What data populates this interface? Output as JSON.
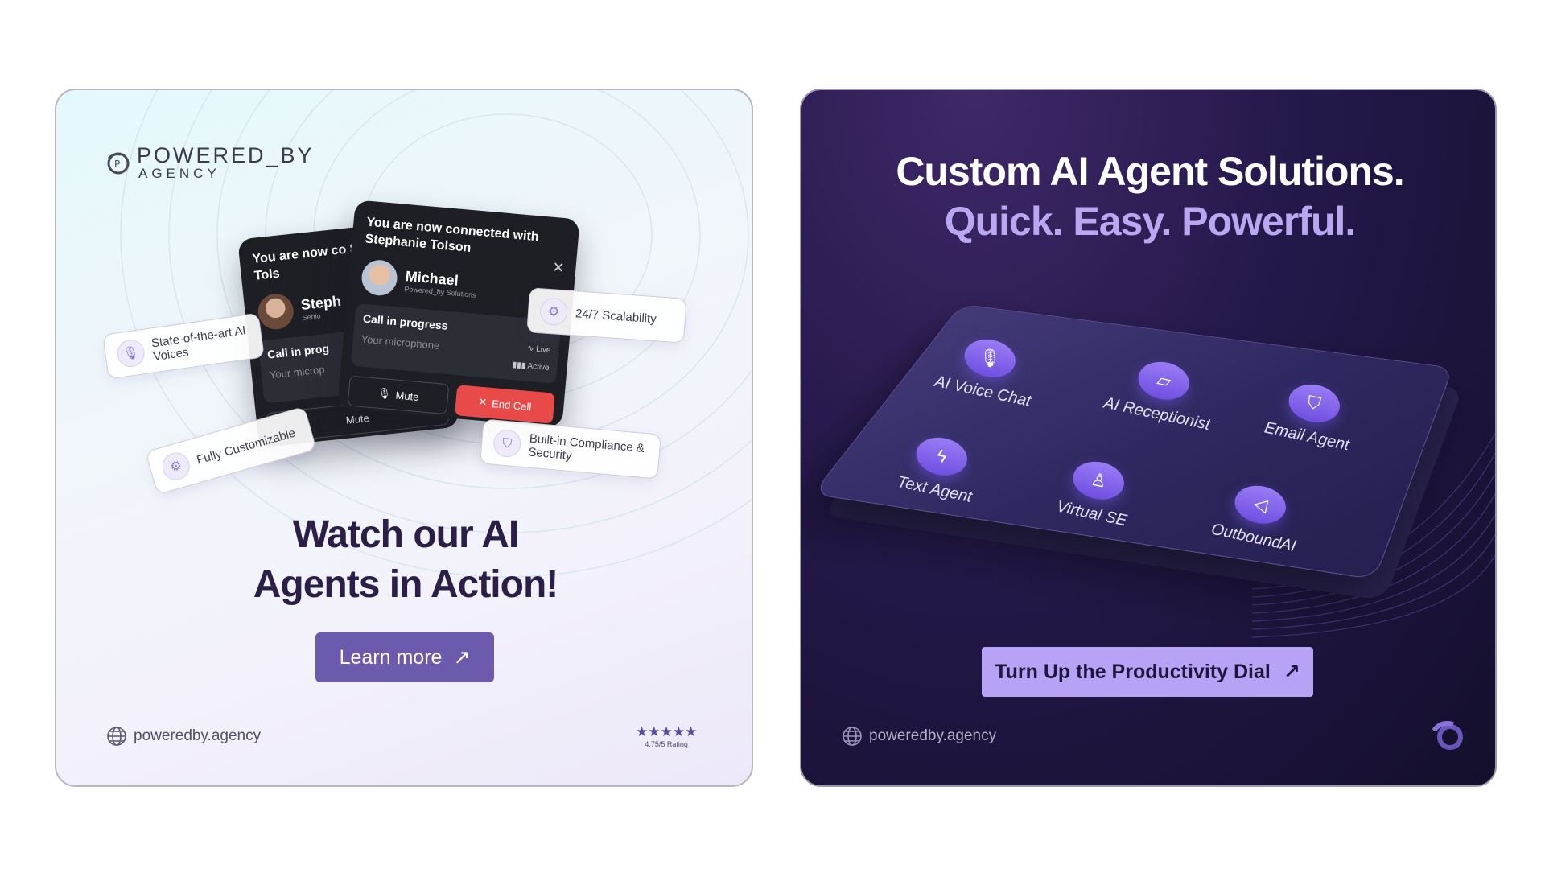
{
  "left_card": {
    "brand": {
      "line1": "POWERED_BY",
      "line2": "AGENCY"
    },
    "call_back": {
      "title": "You are now co Stephanie Tols",
      "caller_name": "Steph",
      "caller_role": "Senio",
      "progress_title": "Call in prog",
      "mic_label": "Your microp",
      "mute_label": "Mute"
    },
    "call_front": {
      "title": "You are now connected with Stephanie Tolson",
      "caller_name": "Michael",
      "caller_company": "Powered_by Solutions",
      "progress_title": "Call in progress",
      "mic_label": "Your microphone",
      "live_label": "Live",
      "active_label": "Active",
      "mute_label": "Mute",
      "end_call_label": "End Call"
    },
    "chips": {
      "voices": "State-of-the-art AI Voices",
      "scalability": "24/7 Scalability",
      "customizable": "Fully Customizable",
      "compliance": "Built-in Compliance & Security"
    },
    "headline_line1": "Watch our AI",
    "headline_line2": "Agents in Action!",
    "cta_label": "Learn more",
    "website": "poweredby.agency",
    "rating_stars": "★★★★★",
    "rating_text": "4.75/5 Rating"
  },
  "right_card": {
    "headline_line1": "Custom AI Agent Solutions.",
    "headline_line2": "Quick. Easy. Powerful.",
    "agents": [
      {
        "label": "AI Voice Chat",
        "icon": "microphone-icon"
      },
      {
        "label": "AI Receptionist",
        "icon": "chat-bubble-icon"
      },
      {
        "label": "Email Agent",
        "icon": "shield-icon"
      },
      {
        "label": "Text Agent",
        "icon": "lightning-icon"
      },
      {
        "label": "Virtual SE",
        "icon": "person-icon"
      },
      {
        "label": "OutboundAI",
        "icon": "megaphone-icon"
      }
    ],
    "cta_label": "Turn Up the Productivity Dial",
    "website": "poweredby.agency"
  },
  "colors": {
    "left_headline": "#2b1e47",
    "left_cta": "#6c5aad",
    "right_accent": "#b9a7f2",
    "right_cta": "#b7a3f5",
    "end_call": "#e84a4a"
  }
}
